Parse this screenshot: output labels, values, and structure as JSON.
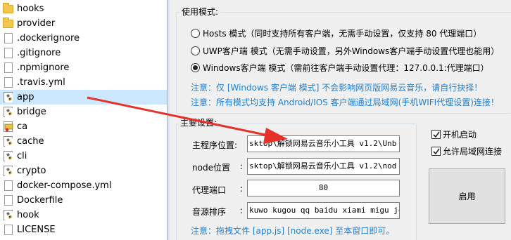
{
  "explorer": {
    "files": [
      {
        "name": "hooks",
        "icon": "folder-icon",
        "selected": false
      },
      {
        "name": "provider",
        "icon": "folder-icon",
        "selected": false
      },
      {
        "name": ".dockerignore",
        "icon": "file-icon",
        "selected": false
      },
      {
        "name": ".gitignore",
        "icon": "file-icon",
        "selected": false
      },
      {
        "name": ".npmignore",
        "icon": "file-icon",
        "selected": false
      },
      {
        "name": ".travis.yml",
        "icon": "file-icon",
        "selected": false
      },
      {
        "name": "app",
        "icon": "batch-file-icon",
        "selected": true
      },
      {
        "name": "bridge",
        "icon": "batch-file-icon",
        "selected": false
      },
      {
        "name": "ca",
        "icon": "certificate-icon",
        "selected": false
      },
      {
        "name": "cache",
        "icon": "batch-file-icon",
        "selected": false
      },
      {
        "name": "cli",
        "icon": "batch-file-icon",
        "selected": false
      },
      {
        "name": "crypto",
        "icon": "batch-file-icon",
        "selected": false
      },
      {
        "name": "docker-compose.yml",
        "icon": "file-icon",
        "selected": false
      },
      {
        "name": "Dockerfile",
        "icon": "file-icon",
        "selected": false
      },
      {
        "name": "hook",
        "icon": "batch-file-icon",
        "selected": false
      },
      {
        "name": "LICENSE",
        "icon": "file-icon",
        "selected": false
      }
    ]
  },
  "mode_group": {
    "title": "使用模式:",
    "options": [
      {
        "label": "Hosts 模式（同时支持所有客户端，无需手动设置，仅支持 80 代理端口）",
        "checked": false
      },
      {
        "label": "UWP客户端 模式（无需手动设置，另外Windows客户端手动设置代理也能用）",
        "checked": false
      },
      {
        "label": "Windows客户端 模式（需前往客户端手动设置代理：127.0.0.1:代理端口）",
        "checked": true
      }
    ],
    "note1": "注意：仅 [Windows 客户端 模式] 不会影响网页版网易云音乐，请自行抉择！",
    "note2": "注意：所有模式均支持 Android/IOS 客户端通过局域网(手机WIFI代理设置)连接！"
  },
  "main_group": {
    "title": "主要设置:",
    "fields": [
      {
        "label": "主程序位置:",
        "value": "sktop\\解锁网易云音乐小工具 v1.2\\Unb",
        "colon": ""
      },
      {
        "label": "node位置",
        "value": "sktop\\解锁网易云音乐小工具 v1.2\\nod",
        "colon": ":"
      },
      {
        "label": "代理端口",
        "value": "80",
        "colon": ":"
      },
      {
        "label": "音源排序",
        "value": "kuwo kugou qq baidu xiami migu joox",
        "colon": ":"
      }
    ],
    "note": "注意：拖拽文件 [app.js] [node.exe] 至本窗口即可。"
  },
  "options": {
    "autostart_label": "开机启动",
    "autostart_checked": true,
    "lan_label": "允许局域网连接",
    "lan_checked": true
  },
  "start_button": "启用",
  "colors": {
    "selection": "#cce8ff",
    "note_blue": "#1e7fd2",
    "arrow_red": "#e8302a",
    "window_bg": "#f0f0f0"
  }
}
